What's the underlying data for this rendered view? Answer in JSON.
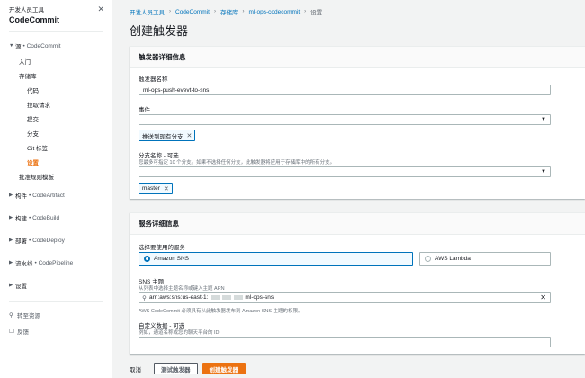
{
  "sidebar": {
    "service_label": "开发人员工具",
    "title": "CodeCommit",
    "groups": [
      {
        "name": "源",
        "sub": "• CodeCommit",
        "expanded": true
      },
      {
        "name": "构件",
        "sub": "• CodeArtifact"
      },
      {
        "name": "构建",
        "sub": "• CodeBuild"
      },
      {
        "name": "部署",
        "sub": "• CodeDeploy"
      },
      {
        "name": "流水线",
        "sub": "• CodePipeline"
      },
      {
        "name": "设置",
        "sub": ""
      }
    ],
    "items": {
      "getting_started": "入门",
      "repositories": "存储库",
      "code": "代码",
      "pull_requests": "拉取请求",
      "commits": "提交",
      "branches": "分支",
      "git_tags": "Git 标签",
      "settings": "设置",
      "approval_templates": "批准规则模板"
    },
    "utils": {
      "go_to_resource": "转至资源",
      "feedback": "反馈"
    }
  },
  "breadcrumb": [
    "开发人员工具",
    "CodeCommit",
    "存储库",
    "ml-ops-codecommit",
    "设置"
  ],
  "page_title": "创建触发器",
  "trigger_panel": {
    "heading": "触发器详细信息",
    "name_label": "触发器名称",
    "name_value": "ml-ops-push-evevt-to-sns",
    "events_label": "事件",
    "events_token": "推送到现有分支",
    "branch_label": "分支名称 - 可选",
    "branch_desc": "您最多可指定 10 个分支。如果不选择任何分支，此触发器将应用于存储库中的所有分支。",
    "branch_token": "master"
  },
  "service_panel": {
    "heading": "服务详细信息",
    "service_label": "选择要使用的服务",
    "option_sns": "Amazon SNS",
    "option_lambda": "AWS Lambda",
    "sns_label": "SNS 主题",
    "sns_desc": "从列表中选择主题名称或键入主题 ARN",
    "sns_value_prefix": "arn:aws:sns:us-east-1:",
    "sns_value_suffix": "ml-ops-sns",
    "sns_help": "AWS CodeCommit 必须具有从此触发器发布到 Amazon SNS 主题的权限。",
    "custom_label": "自定义数据 - 可选",
    "custom_desc": "例如，通道名称或您的聊天平台的 ID"
  },
  "footer": {
    "cancel": "取消",
    "test": "测试触发器",
    "create": "创建触发器"
  },
  "colors": {
    "accent": "#ec7211",
    "link": "#0073bb"
  }
}
